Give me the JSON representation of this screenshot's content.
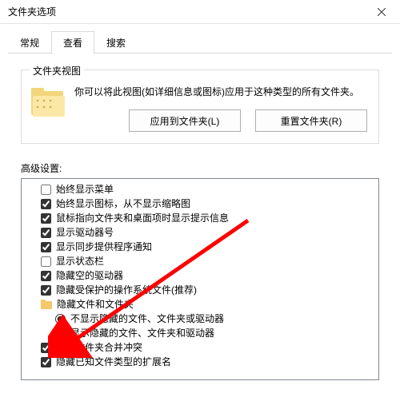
{
  "window": {
    "title": "文件夹选项"
  },
  "tabs": {
    "general": "常规",
    "view": "查看",
    "search": "搜索"
  },
  "folderViews": {
    "groupLabel": "文件夹视图",
    "description": "你可以将此视图(如详细信息或图标)应用于这种类型的所有文件夹。",
    "applyBtn": "应用到文件夹(L)",
    "resetBtn": "重置文件夹(R)"
  },
  "advanced": {
    "label": "高级设置:",
    "items": [
      {
        "type": "checkbox",
        "checked": false,
        "text": "始终显示菜单"
      },
      {
        "type": "checkbox",
        "checked": true,
        "text": "始终显示图标，从不显示缩略图"
      },
      {
        "type": "checkbox",
        "checked": true,
        "text": "鼠标指向文件夹和桌面项时显示提示信息"
      },
      {
        "type": "checkbox",
        "checked": true,
        "text": "显示驱动器号"
      },
      {
        "type": "checkbox",
        "checked": true,
        "text": "显示同步提供程序通知"
      },
      {
        "type": "checkbox",
        "checked": false,
        "text": "显示状态栏"
      },
      {
        "type": "checkbox",
        "checked": true,
        "text": "隐藏空的驱动器"
      },
      {
        "type": "checkbox",
        "checked": true,
        "text": "隐藏受保护的操作系统文件(推荐)"
      },
      {
        "type": "folder",
        "text": "隐藏文件和文件夹"
      },
      {
        "type": "radio",
        "checked": true,
        "text": "不显示隐藏的文件、文件夹或驱动器"
      },
      {
        "type": "radio",
        "checked": false,
        "text": "显示隐藏的文件、文件夹和驱动器"
      },
      {
        "type": "checkbox",
        "checked": true,
        "text": "隐藏文件夹合并冲突"
      },
      {
        "type": "checkbox",
        "checked": true,
        "text": "隐藏已知文件类型的扩展名"
      }
    ]
  }
}
